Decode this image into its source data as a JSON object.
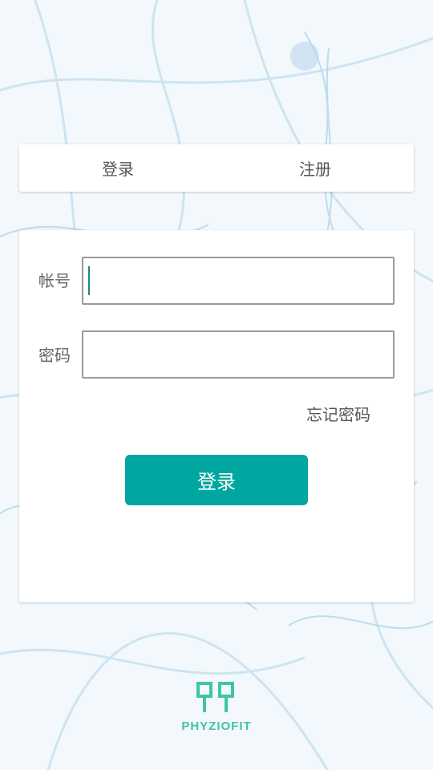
{
  "tabs": {
    "login": "登录",
    "register": "注册"
  },
  "form": {
    "account_label": "帐号",
    "account_value": "",
    "password_label": "密码",
    "password_value": "",
    "forgot_password": "忘记密码",
    "submit_label": "登录"
  },
  "brand": {
    "logo_text": "PHYZIOFIT",
    "logo_icon": "phyziofit-logo",
    "accent_color": "#00a6a0"
  }
}
